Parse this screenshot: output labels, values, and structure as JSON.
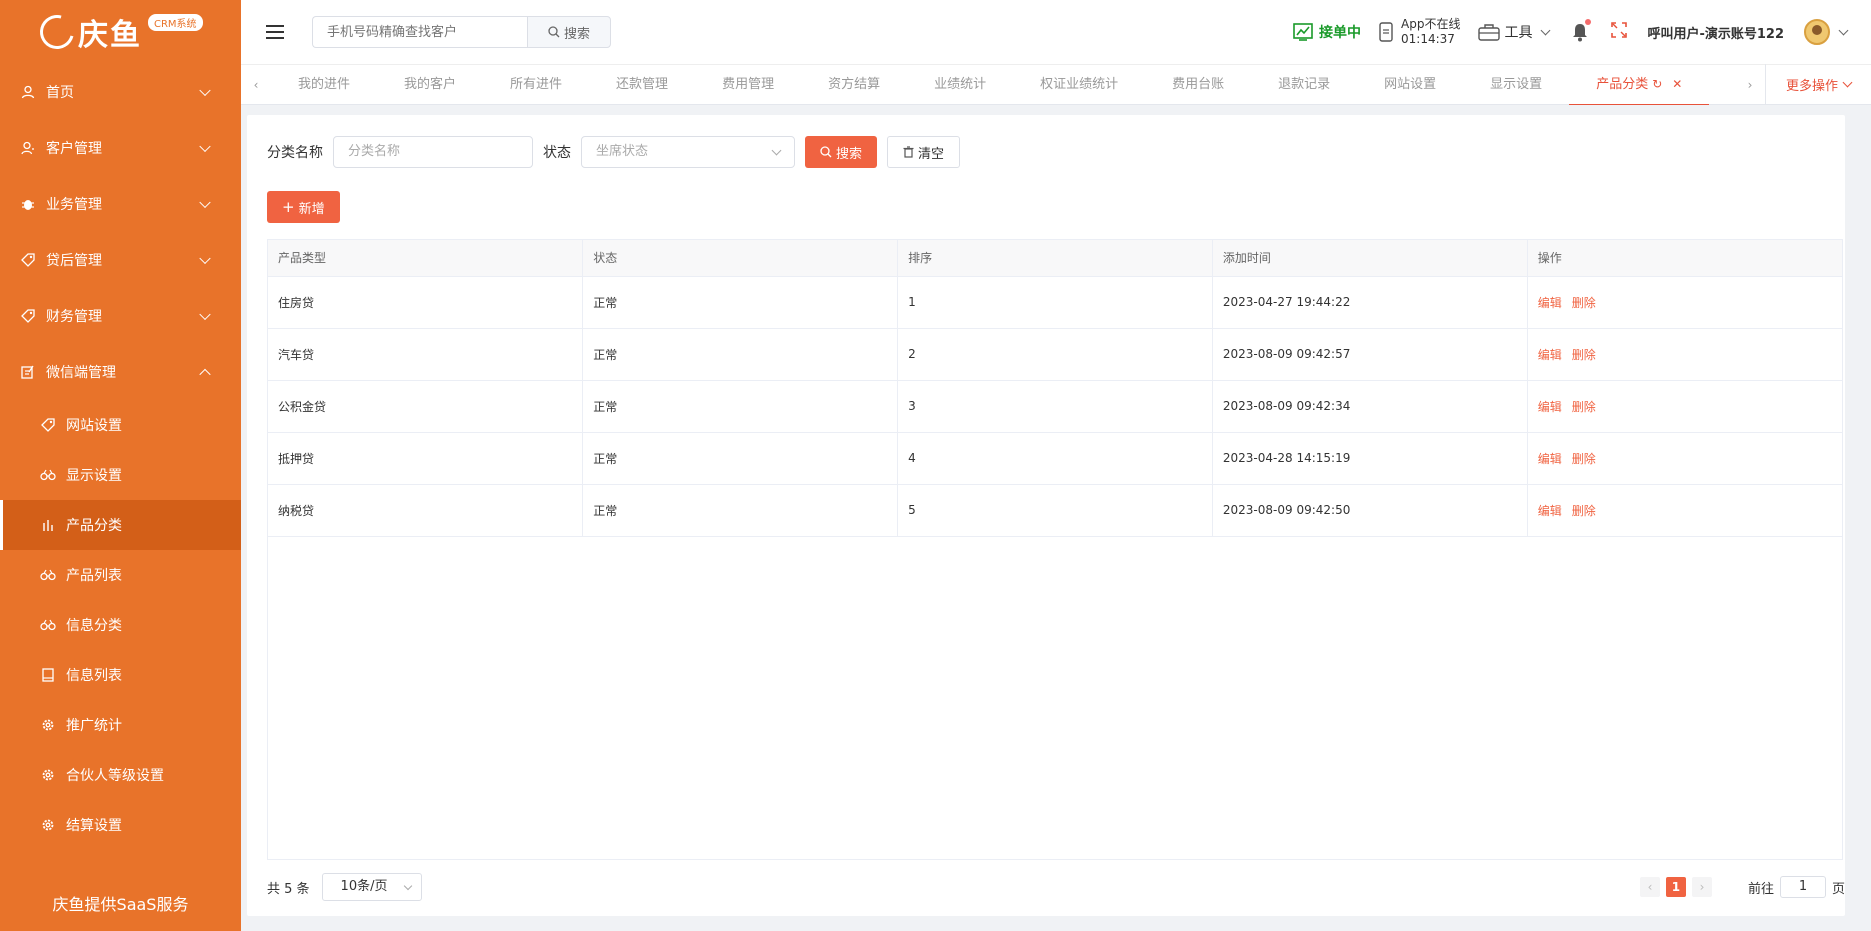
{
  "brand": {
    "name": "庆鱼",
    "badge": "CRM系统",
    "footer": "庆鱼提供SaaS服务"
  },
  "sidebar": {
    "menus": [
      {
        "label": "首页",
        "icon": "user-icon"
      },
      {
        "label": "客户管理",
        "icon": "customer-icon"
      },
      {
        "label": "业务管理",
        "icon": "bug-icon"
      },
      {
        "label": "贷后管理",
        "icon": "tag-icon"
      },
      {
        "label": "财务管理",
        "icon": "tag-icon"
      },
      {
        "label": "微信端管理",
        "icon": "edit-icon"
      }
    ],
    "sub_items": [
      {
        "label": "网站设置",
        "icon": "tag-icon"
      },
      {
        "label": "显示设置",
        "icon": "glasses-icon"
      },
      {
        "label": "产品分类",
        "icon": "chart-icon"
      },
      {
        "label": "产品列表",
        "icon": "glasses-icon"
      },
      {
        "label": "信息分类",
        "icon": "glasses-icon"
      },
      {
        "label": "信息列表",
        "icon": "book-icon"
      },
      {
        "label": "推广统计",
        "icon": "gear-icon"
      },
      {
        "label": "合伙人等级设置",
        "icon": "gear-icon"
      },
      {
        "label": "结算设置",
        "icon": "gear-icon"
      }
    ],
    "active_sub": "产品分类"
  },
  "header": {
    "search_placeholder": "手机号码精确查找客户",
    "search_button": "搜索",
    "accept_status": "接单中",
    "app_status": "App不在线",
    "app_time": "01:14:37",
    "tools": "工具",
    "user": "呼叫用户-演示账号122"
  },
  "tabs": {
    "items": [
      "我的进件",
      "我的客户",
      "所有进件",
      "还款管理",
      "费用管理",
      "资方结算",
      "业绩统计",
      "权证业绩统计",
      "费用台账",
      "退款记录",
      "网站设置",
      "显示设置",
      "产品分类"
    ],
    "active": "产品分类",
    "more": "更多操作"
  },
  "filter": {
    "name_label": "分类名称",
    "name_placeholder": "分类名称",
    "status_label": "状态",
    "status_placeholder": "坐席状态",
    "search_button": "搜索",
    "clear_button": "清空",
    "add_button": "新增"
  },
  "table": {
    "columns": [
      "产品类型",
      "状态",
      "排序",
      "添加时间",
      "操作"
    ],
    "rows": [
      {
        "type": "住房贷",
        "status": "正常",
        "sort": "1",
        "time": "2023-04-27 19:44:22"
      },
      {
        "type": "汽车贷",
        "status": "正常",
        "sort": "2",
        "time": "2023-08-09 09:42:57"
      },
      {
        "type": "公积金贷",
        "status": "正常",
        "sort": "3",
        "time": "2023-08-09 09:42:34"
      },
      {
        "type": "抵押贷",
        "status": "正常",
        "sort": "4",
        "time": "2023-04-28 14:15:19"
      },
      {
        "type": "纳税贷",
        "status": "正常",
        "sort": "5",
        "time": "2023-08-09 09:42:50"
      }
    ],
    "edit_label": "编辑",
    "delete_label": "删除"
  },
  "pagination": {
    "total": "共 5 条",
    "page_size": "10条/页",
    "current": "1",
    "goto_label": "前往",
    "goto_value": "1",
    "goto_suffix": "页"
  },
  "colors": {
    "sidebar": "#e8732a",
    "accent": "#f06341",
    "active_sub": "#d35f18",
    "accept": "#1a9a2a"
  }
}
